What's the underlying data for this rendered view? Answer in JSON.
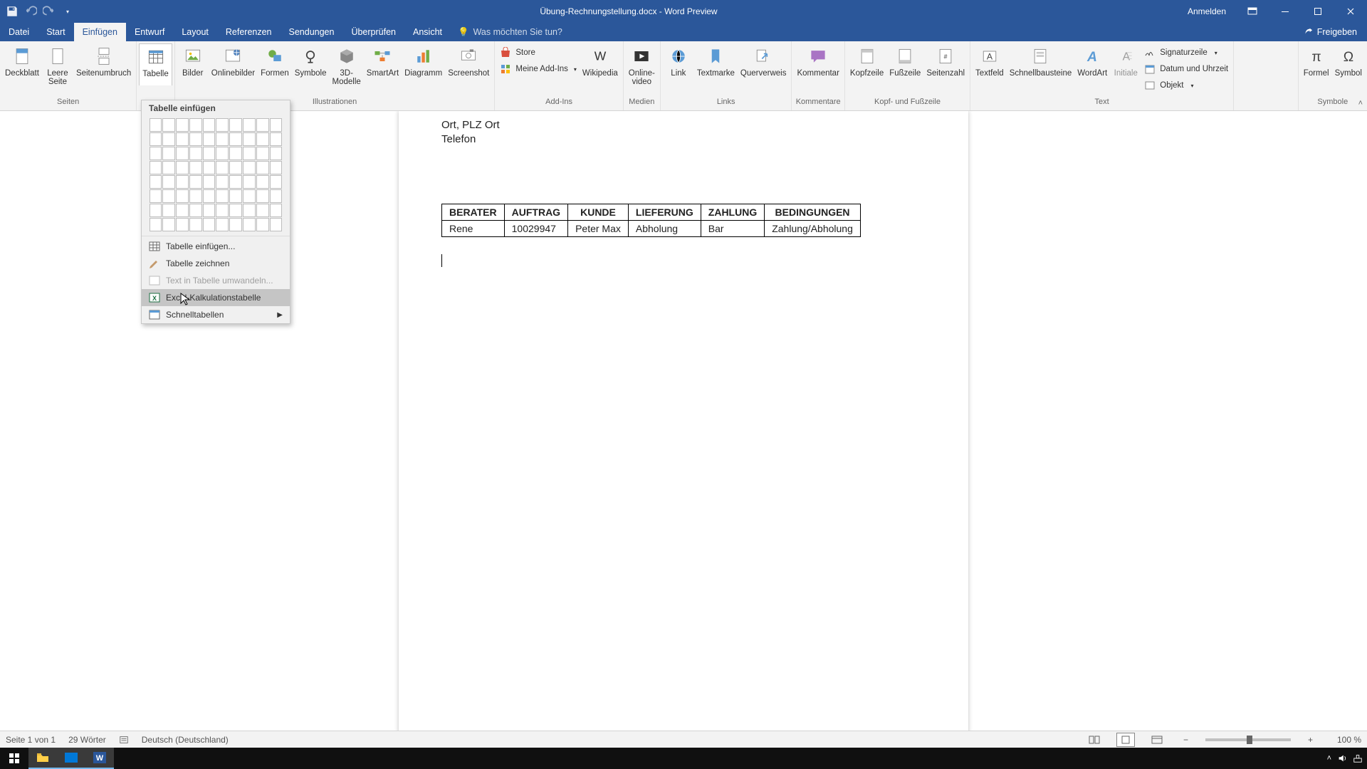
{
  "titlebar": {
    "doc_title": "Übung-Rechnungstellung.docx - Word Preview",
    "signin": "Anmelden"
  },
  "tabs": {
    "datei": "Datei",
    "start": "Start",
    "einfuegen": "Einfügen",
    "entwurf": "Entwurf",
    "layout": "Layout",
    "referenzen": "Referenzen",
    "sendungen": "Sendungen",
    "ueberpruefen": "Überprüfen",
    "ansicht": "Ansicht",
    "tellme": "Was möchten Sie tun?",
    "share": "Freigeben"
  },
  "ribbon": {
    "seiten": {
      "deckblatt": "Deckblatt",
      "leere": "Leere\nSeite",
      "umbruch": "Seitenumbruch",
      "group": "Seiten"
    },
    "tabellen": {
      "tabelle": "Tabelle"
    },
    "illustr": {
      "bilder": "Bilder",
      "online": "Onlinebilder",
      "formen": "Formen",
      "symbole": "Symbole",
      "dmodelle": "3D-\nModelle",
      "smartart": "SmartArt",
      "diagramm": "Diagramm",
      "screenshot": "Screenshot",
      "group": "Illustrationen"
    },
    "addins": {
      "store": "Store",
      "myaddins": "Meine Add-Ins",
      "wikipedia": "Wikipedia",
      "group": "Add-Ins"
    },
    "medien": {
      "onlinevideo": "Online-\nvideo",
      "group": "Medien"
    },
    "links": {
      "link": "Link",
      "textmarke": "Textmarke",
      "querverweis": "Querverweis",
      "group": "Links"
    },
    "kommentar": {
      "kommentar": "Kommentar",
      "group": "Kommentare"
    },
    "kopfuss": {
      "kopfzeile": "Kopfzeile",
      "fusszeile": "Fußzeile",
      "seitenzahl": "Seitenzahl",
      "group": "Kopf- und Fußzeile"
    },
    "text": {
      "textfeld": "Textfeld",
      "schnellbausteine": "Schnellbausteine",
      "wordart": "WordArt",
      "initiale": "Initiale",
      "sigzeile": "Signaturzeile",
      "datum": "Datum und Uhrzeit",
      "objekt": "Objekt",
      "group": "Text"
    },
    "symbole": {
      "formel": "Formel",
      "symbol": "Symbol",
      "group": "Symbole"
    }
  },
  "table_menu": {
    "header": "Tabelle einfügen",
    "insert": "Tabelle einfügen...",
    "draw": "Tabelle zeichnen",
    "convert": "Text in Tabelle umwandeln...",
    "excel": "Excel-Kalkulationstabelle",
    "quick": "Schnelltabellen"
  },
  "document": {
    "addr1": "Ort, PLZ Ort",
    "addr2": "Telefon",
    "headers": [
      "BERATER",
      "AUFTRAG",
      "KUNDE",
      "LIEFERUNG",
      "ZAHLUNG",
      "BEDINGUNGEN"
    ],
    "row": [
      "Rene",
      "10029947",
      "Peter Max",
      "Abholung",
      "Bar",
      "Zahlung/Abholung"
    ]
  },
  "status": {
    "page": "Seite 1 von 1",
    "words": "29 Wörter",
    "lang": "Deutsch (Deutschland)",
    "zoom": "100 %"
  }
}
